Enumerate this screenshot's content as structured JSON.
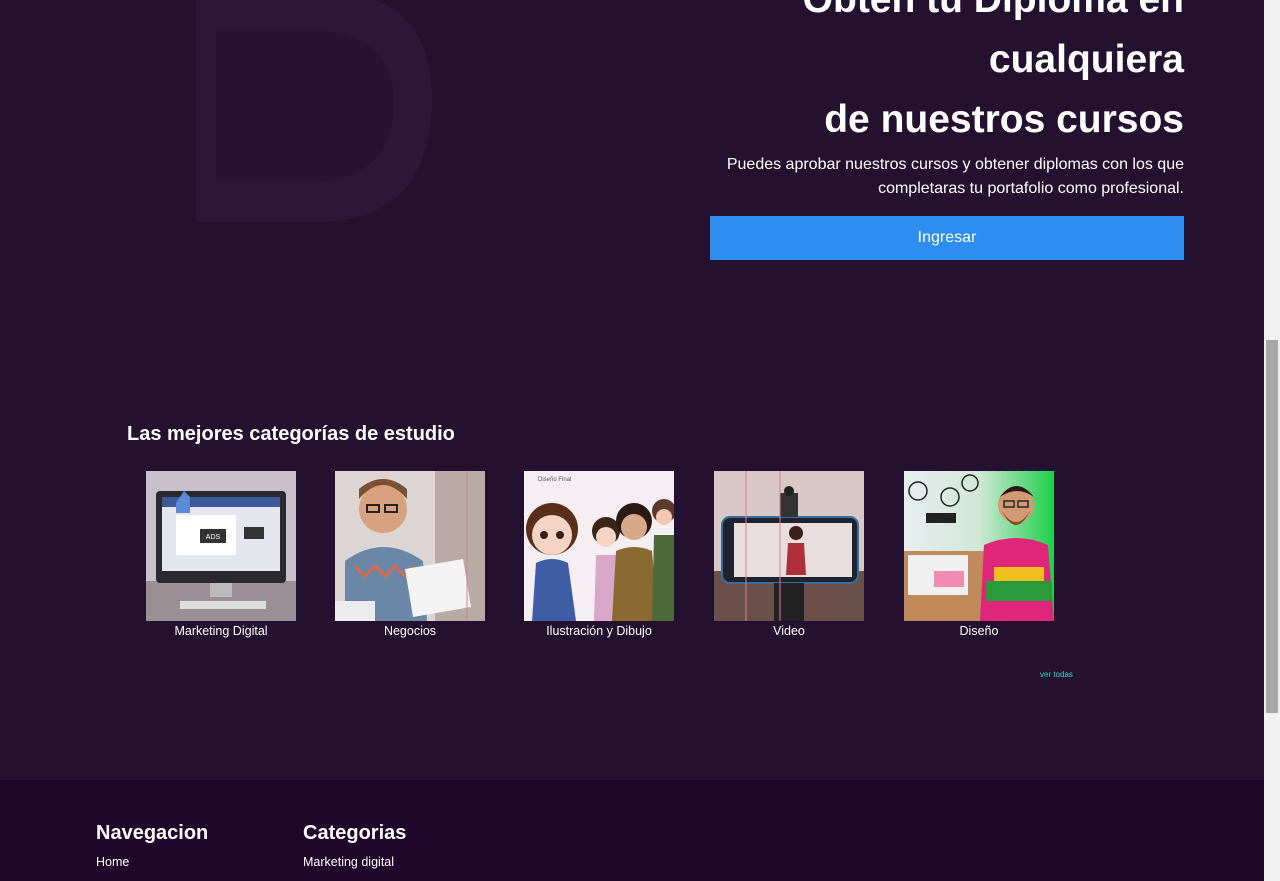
{
  "hero": {
    "title_line1": "Obtén tu Diploma en",
    "title_line2": "cualquiera",
    "title_line3": "de nuestros cursos",
    "subtitle": "Puedes aprobar nuestros cursos y obtener diplomas con los que completaras tu portafolio como profesional.",
    "button_label": "Ingresar",
    "button_color": "#2d8ef0"
  },
  "categories": {
    "title": "Las mejores categorías de estudio",
    "items": [
      {
        "label": "Marketing Digital"
      },
      {
        "label": "Negocios"
      },
      {
        "label": "Ilustración y Dibujo"
      },
      {
        "label": "Video"
      },
      {
        "label": "Diseño"
      }
    ],
    "see_all": "ver todas"
  },
  "footer": {
    "nav_title": "Navegacion",
    "nav_items": [
      "Home"
    ],
    "cat_title": "Categorias",
    "cat_items": [
      "Marketing digital"
    ]
  },
  "colors": {
    "background": "#241130",
    "footer_bg": "#1f062a",
    "accent_link": "#3fd3c8"
  }
}
